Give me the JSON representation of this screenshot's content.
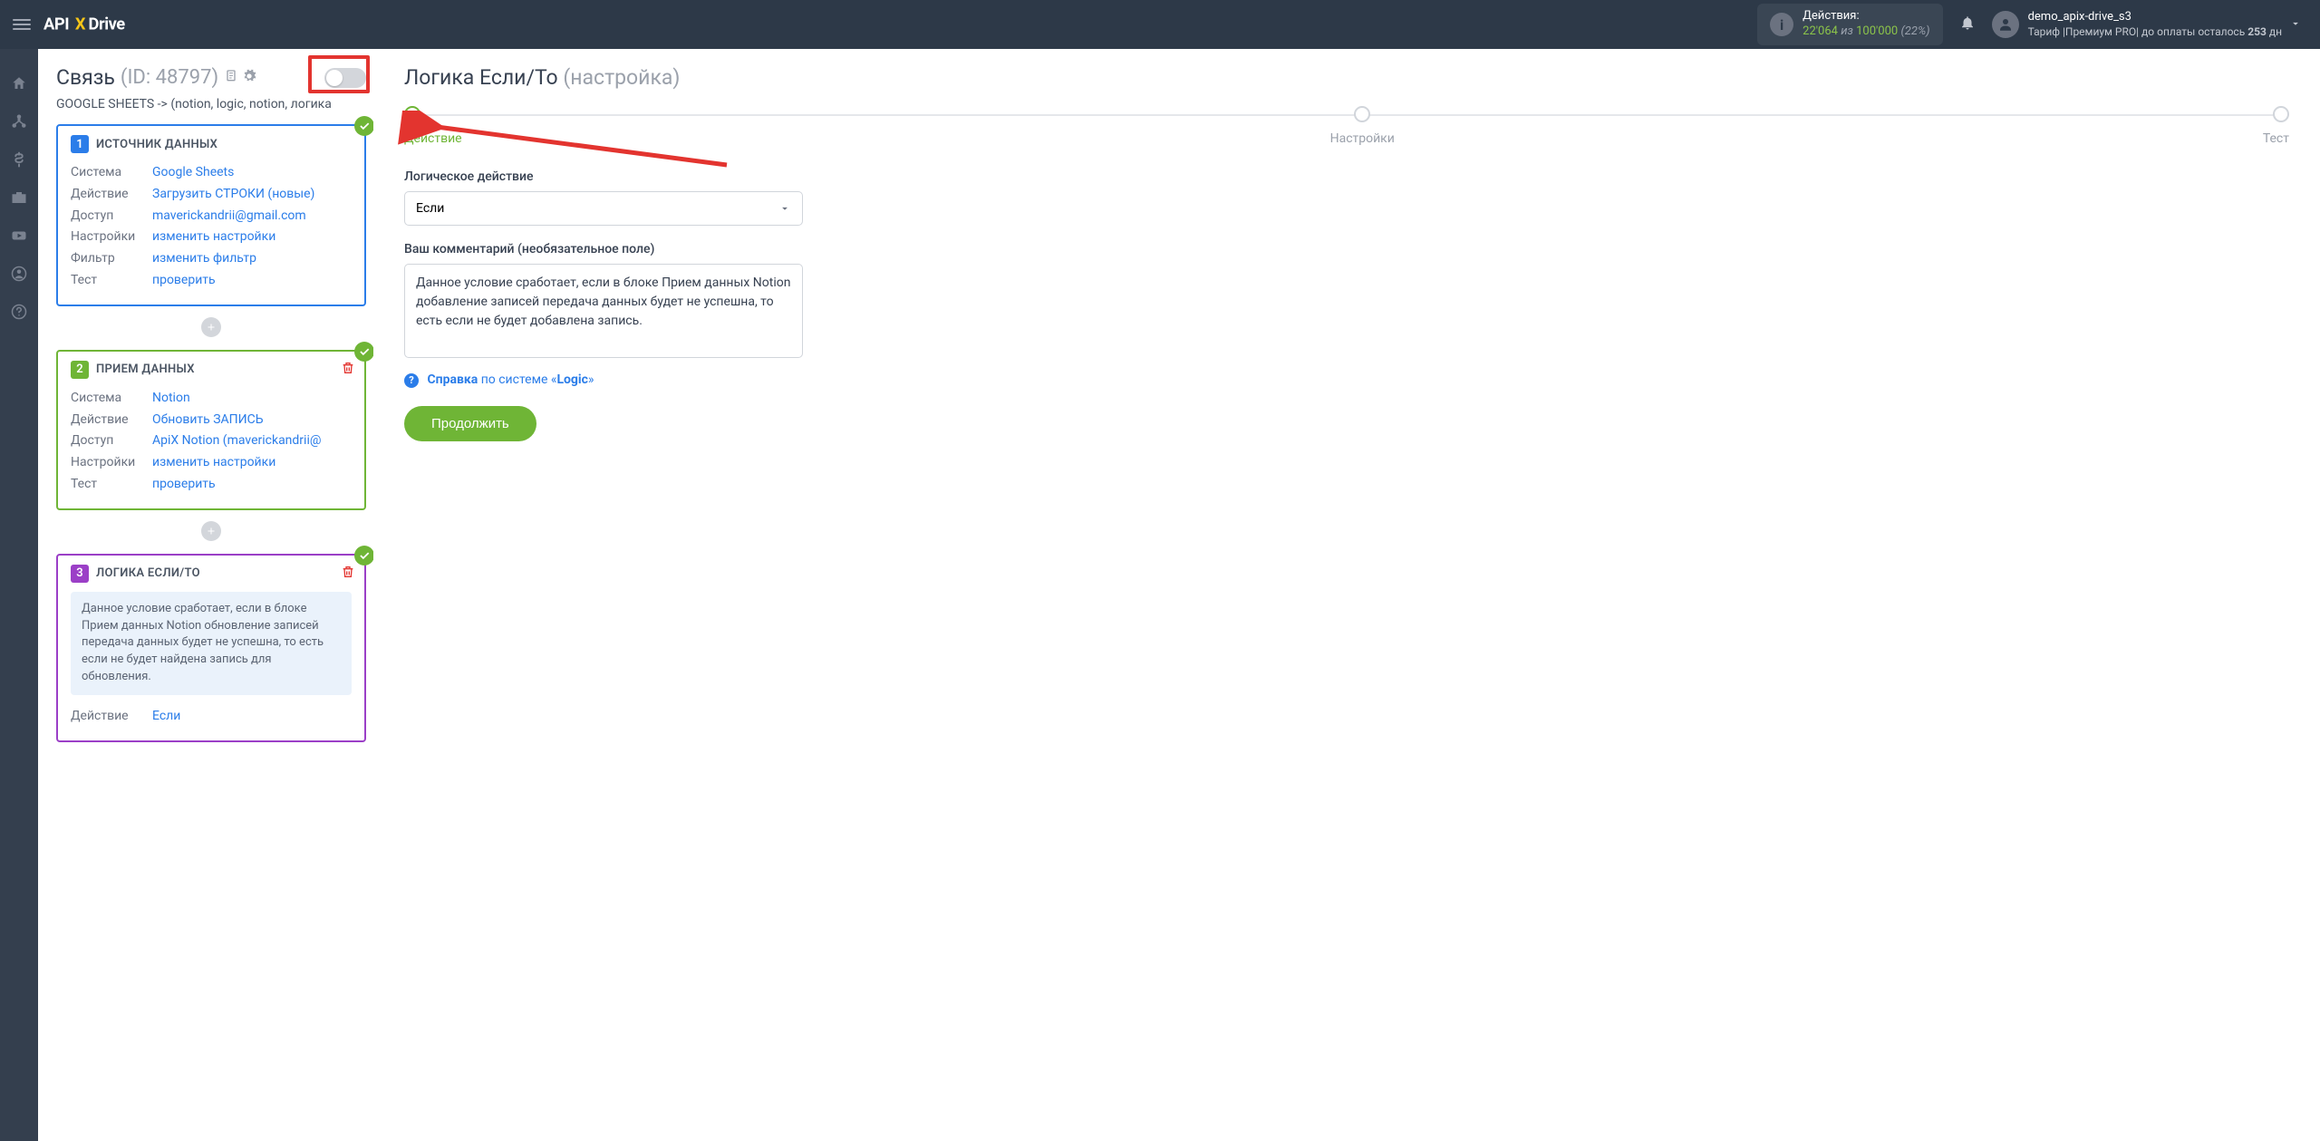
{
  "topbar": {
    "actions_label": "Действия:",
    "actions_used": "22'064",
    "actions_of": "из",
    "actions_total": "100'000",
    "actions_pct": "(22%)",
    "username": "demo_apix-drive_s3",
    "tariff_prefix": "Тариф |Премиум PRO|  до оплаты осталось ",
    "tariff_days": "253",
    "tariff_suffix": " дн"
  },
  "left": {
    "title": "Связь",
    "id_label": "(ID: 48797)",
    "path": "GOOGLE SHEETS -> (notion, logic, notion, логика",
    "card1": {
      "num": "1",
      "title": "ИСТОЧНИК ДАННЫХ",
      "rows": {
        "system_k": "Система",
        "system_v": "Google Sheets",
        "action_k": "Действие",
        "action_v": "Загрузить СТРОКИ (новые)",
        "access_k": "Доступ",
        "access_v": "maverickandrii@gmail.com",
        "settings_k": "Настройки",
        "settings_v": "изменить настройки",
        "filter_k": "Фильтр",
        "filter_v": "изменить фильтр",
        "test_k": "Тест",
        "test_v": "проверить"
      }
    },
    "card2": {
      "num": "2",
      "title": "ПРИЕМ ДАННЫХ",
      "rows": {
        "system_k": "Система",
        "system_v": "Notion",
        "action_k": "Действие",
        "action_v": "Обновить ЗАПИСЬ",
        "access_k": "Доступ",
        "access_v": "ApiX Notion (maverickandrii@",
        "settings_k": "Настройки",
        "settings_v": "изменить настройки",
        "test_k": "Тест",
        "test_v": "проверить"
      }
    },
    "card3": {
      "num": "3",
      "title": "ЛОГИКА ЕСЛИ/ТО",
      "desc": "Данное условие сработает, если в блоке Прием данных Notion обновление записей передача данных будет не успешна, то есть если не будет найдена запись для обновления.",
      "action_k": "Действие",
      "action_v": "Если"
    }
  },
  "right": {
    "title": "Логика Если/То",
    "subtitle": "(настройка)",
    "steps": {
      "s1": "Действие",
      "s2": "Настройки",
      "s3": "Тест"
    },
    "form": {
      "logic_label": "Логическое действие",
      "logic_value": "Если",
      "comment_label": "Ваш комментарий (необязательное поле)",
      "comment_value": "Данное условие сработает, если в блоке Прием данных Notion добавление записей передача данных будет не успешна, то есть если не будет добавлена запись.",
      "help_text": "Справка",
      "help_mid": " по системе «",
      "help_sys": "Logic",
      "help_end": "»",
      "continue": "Продолжить"
    }
  }
}
